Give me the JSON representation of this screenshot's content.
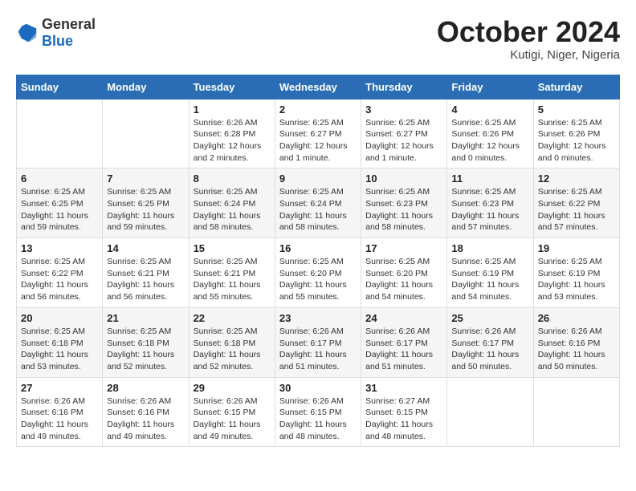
{
  "header": {
    "logo_general": "General",
    "logo_blue": "Blue",
    "title": "October 2024",
    "location": "Kutigi, Niger, Nigeria"
  },
  "days_of_week": [
    "Sunday",
    "Monday",
    "Tuesday",
    "Wednesday",
    "Thursday",
    "Friday",
    "Saturday"
  ],
  "weeks": [
    [
      {
        "day": "",
        "info": ""
      },
      {
        "day": "",
        "info": ""
      },
      {
        "day": "1",
        "sunrise": "Sunrise: 6:26 AM",
        "sunset": "Sunset: 6:28 PM",
        "daylight": "Daylight: 12 hours and 2 minutes."
      },
      {
        "day": "2",
        "sunrise": "Sunrise: 6:25 AM",
        "sunset": "Sunset: 6:27 PM",
        "daylight": "Daylight: 12 hours and 1 minute."
      },
      {
        "day": "3",
        "sunrise": "Sunrise: 6:25 AM",
        "sunset": "Sunset: 6:27 PM",
        "daylight": "Daylight: 12 hours and 1 minute."
      },
      {
        "day": "4",
        "sunrise": "Sunrise: 6:25 AM",
        "sunset": "Sunset: 6:26 PM",
        "daylight": "Daylight: 12 hours and 0 minutes."
      },
      {
        "day": "5",
        "sunrise": "Sunrise: 6:25 AM",
        "sunset": "Sunset: 6:26 PM",
        "daylight": "Daylight: 12 hours and 0 minutes."
      }
    ],
    [
      {
        "day": "6",
        "sunrise": "Sunrise: 6:25 AM",
        "sunset": "Sunset: 6:25 PM",
        "daylight": "Daylight: 11 hours and 59 minutes."
      },
      {
        "day": "7",
        "sunrise": "Sunrise: 6:25 AM",
        "sunset": "Sunset: 6:25 PM",
        "daylight": "Daylight: 11 hours and 59 minutes."
      },
      {
        "day": "8",
        "sunrise": "Sunrise: 6:25 AM",
        "sunset": "Sunset: 6:24 PM",
        "daylight": "Daylight: 11 hours and 58 minutes."
      },
      {
        "day": "9",
        "sunrise": "Sunrise: 6:25 AM",
        "sunset": "Sunset: 6:24 PM",
        "daylight": "Daylight: 11 hours and 58 minutes."
      },
      {
        "day": "10",
        "sunrise": "Sunrise: 6:25 AM",
        "sunset": "Sunset: 6:23 PM",
        "daylight": "Daylight: 11 hours and 58 minutes."
      },
      {
        "day": "11",
        "sunrise": "Sunrise: 6:25 AM",
        "sunset": "Sunset: 6:23 PM",
        "daylight": "Daylight: 11 hours and 57 minutes."
      },
      {
        "day": "12",
        "sunrise": "Sunrise: 6:25 AM",
        "sunset": "Sunset: 6:22 PM",
        "daylight": "Daylight: 11 hours and 57 minutes."
      }
    ],
    [
      {
        "day": "13",
        "sunrise": "Sunrise: 6:25 AM",
        "sunset": "Sunset: 6:22 PM",
        "daylight": "Daylight: 11 hours and 56 minutes."
      },
      {
        "day": "14",
        "sunrise": "Sunrise: 6:25 AM",
        "sunset": "Sunset: 6:21 PM",
        "daylight": "Daylight: 11 hours and 56 minutes."
      },
      {
        "day": "15",
        "sunrise": "Sunrise: 6:25 AM",
        "sunset": "Sunset: 6:21 PM",
        "daylight": "Daylight: 11 hours and 55 minutes."
      },
      {
        "day": "16",
        "sunrise": "Sunrise: 6:25 AM",
        "sunset": "Sunset: 6:20 PM",
        "daylight": "Daylight: 11 hours and 55 minutes."
      },
      {
        "day": "17",
        "sunrise": "Sunrise: 6:25 AM",
        "sunset": "Sunset: 6:20 PM",
        "daylight": "Daylight: 11 hours and 54 minutes."
      },
      {
        "day": "18",
        "sunrise": "Sunrise: 6:25 AM",
        "sunset": "Sunset: 6:19 PM",
        "daylight": "Daylight: 11 hours and 54 minutes."
      },
      {
        "day": "19",
        "sunrise": "Sunrise: 6:25 AM",
        "sunset": "Sunset: 6:19 PM",
        "daylight": "Daylight: 11 hours and 53 minutes."
      }
    ],
    [
      {
        "day": "20",
        "sunrise": "Sunrise: 6:25 AM",
        "sunset": "Sunset: 6:18 PM",
        "daylight": "Daylight: 11 hours and 53 minutes."
      },
      {
        "day": "21",
        "sunrise": "Sunrise: 6:25 AM",
        "sunset": "Sunset: 6:18 PM",
        "daylight": "Daylight: 11 hours and 52 minutes."
      },
      {
        "day": "22",
        "sunrise": "Sunrise: 6:25 AM",
        "sunset": "Sunset: 6:18 PM",
        "daylight": "Daylight: 11 hours and 52 minutes."
      },
      {
        "day": "23",
        "sunrise": "Sunrise: 6:26 AM",
        "sunset": "Sunset: 6:17 PM",
        "daylight": "Daylight: 11 hours and 51 minutes."
      },
      {
        "day": "24",
        "sunrise": "Sunrise: 6:26 AM",
        "sunset": "Sunset: 6:17 PM",
        "daylight": "Daylight: 11 hours and 51 minutes."
      },
      {
        "day": "25",
        "sunrise": "Sunrise: 6:26 AM",
        "sunset": "Sunset: 6:17 PM",
        "daylight": "Daylight: 11 hours and 50 minutes."
      },
      {
        "day": "26",
        "sunrise": "Sunrise: 6:26 AM",
        "sunset": "Sunset: 6:16 PM",
        "daylight": "Daylight: 11 hours and 50 minutes."
      }
    ],
    [
      {
        "day": "27",
        "sunrise": "Sunrise: 6:26 AM",
        "sunset": "Sunset: 6:16 PM",
        "daylight": "Daylight: 11 hours and 49 minutes."
      },
      {
        "day": "28",
        "sunrise": "Sunrise: 6:26 AM",
        "sunset": "Sunset: 6:16 PM",
        "daylight": "Daylight: 11 hours and 49 minutes."
      },
      {
        "day": "29",
        "sunrise": "Sunrise: 6:26 AM",
        "sunset": "Sunset: 6:15 PM",
        "daylight": "Daylight: 11 hours and 49 minutes."
      },
      {
        "day": "30",
        "sunrise": "Sunrise: 6:26 AM",
        "sunset": "Sunset: 6:15 PM",
        "daylight": "Daylight: 11 hours and 48 minutes."
      },
      {
        "day": "31",
        "sunrise": "Sunrise: 6:27 AM",
        "sunset": "Sunset: 6:15 PM",
        "daylight": "Daylight: 11 hours and 48 minutes."
      },
      {
        "day": "",
        "info": ""
      },
      {
        "day": "",
        "info": ""
      }
    ]
  ]
}
